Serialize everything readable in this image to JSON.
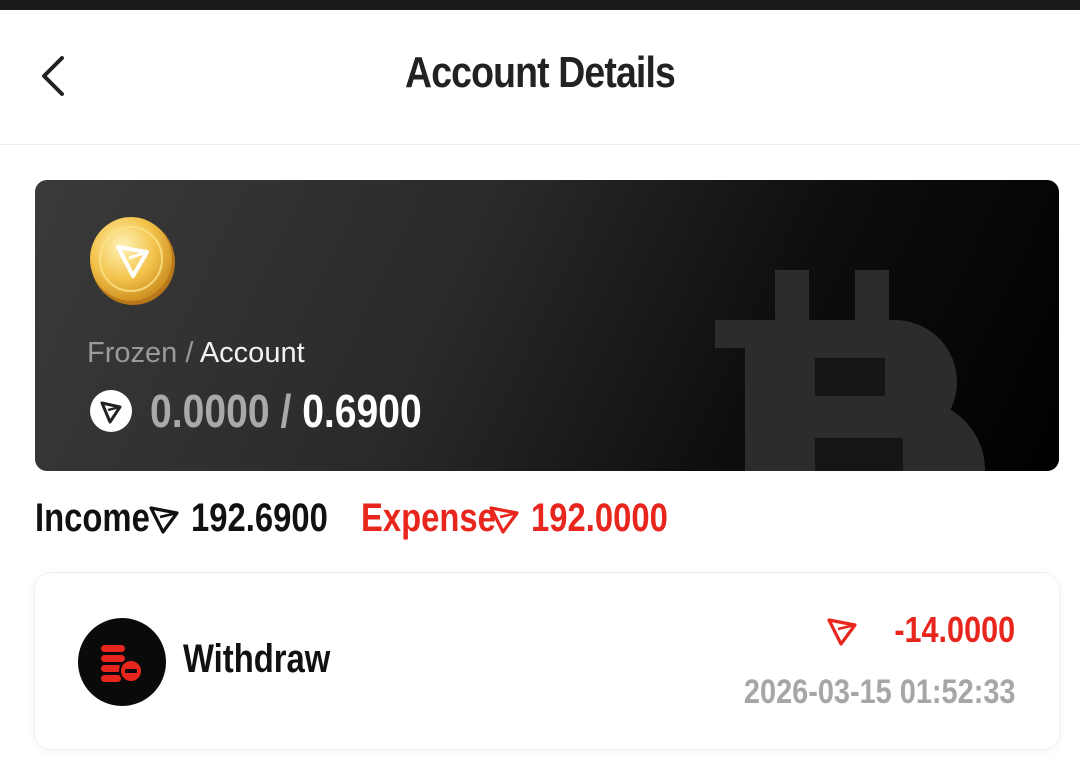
{
  "header": {
    "title": "Account Details",
    "back_icon": "chevron-left-icon"
  },
  "balance_card": {
    "coin_icon": "tron-gold-coin-icon",
    "watermark_icon": "bitcoin-icon",
    "label_frozen": "Frozen",
    "label_separator": " / ",
    "label_account": "Account",
    "currency_icon": "tron-icon",
    "frozen_value": "0.0000",
    "value_separator": " / ",
    "account_value": "0.6900"
  },
  "summary": {
    "income_label": "Income",
    "income_value": "192.6900",
    "expense_label": "Expense",
    "expense_value": "192.0000"
  },
  "transactions": [
    {
      "icon": "withdraw-coins-icon",
      "type": "Withdraw",
      "amount": "-14.0000",
      "time": "2026-03-15 01:52:33"
    }
  ],
  "colors": {
    "accent_red": "#e8261d",
    "card_dark": "#000000",
    "muted_gray": "#a6a6a6"
  }
}
